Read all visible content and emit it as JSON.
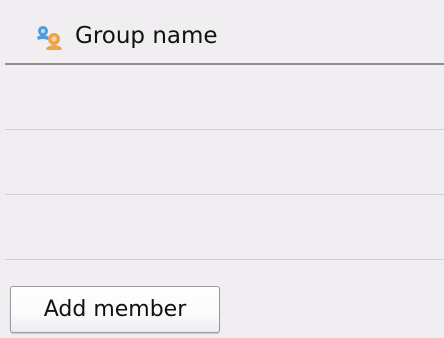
{
  "header": {
    "icon": "group-contacts-icon",
    "title": "Group name"
  },
  "members": {
    "rows": [
      "",
      "",
      ""
    ]
  },
  "actions": {
    "add_member_label": "Add member"
  },
  "colors": {
    "background": "#f0eef1",
    "header_divider": "#8f8d92",
    "row_divider": "#d3d1d6",
    "icon_blue": "#4f9bdc",
    "icon_orange": "#f0a24a"
  }
}
